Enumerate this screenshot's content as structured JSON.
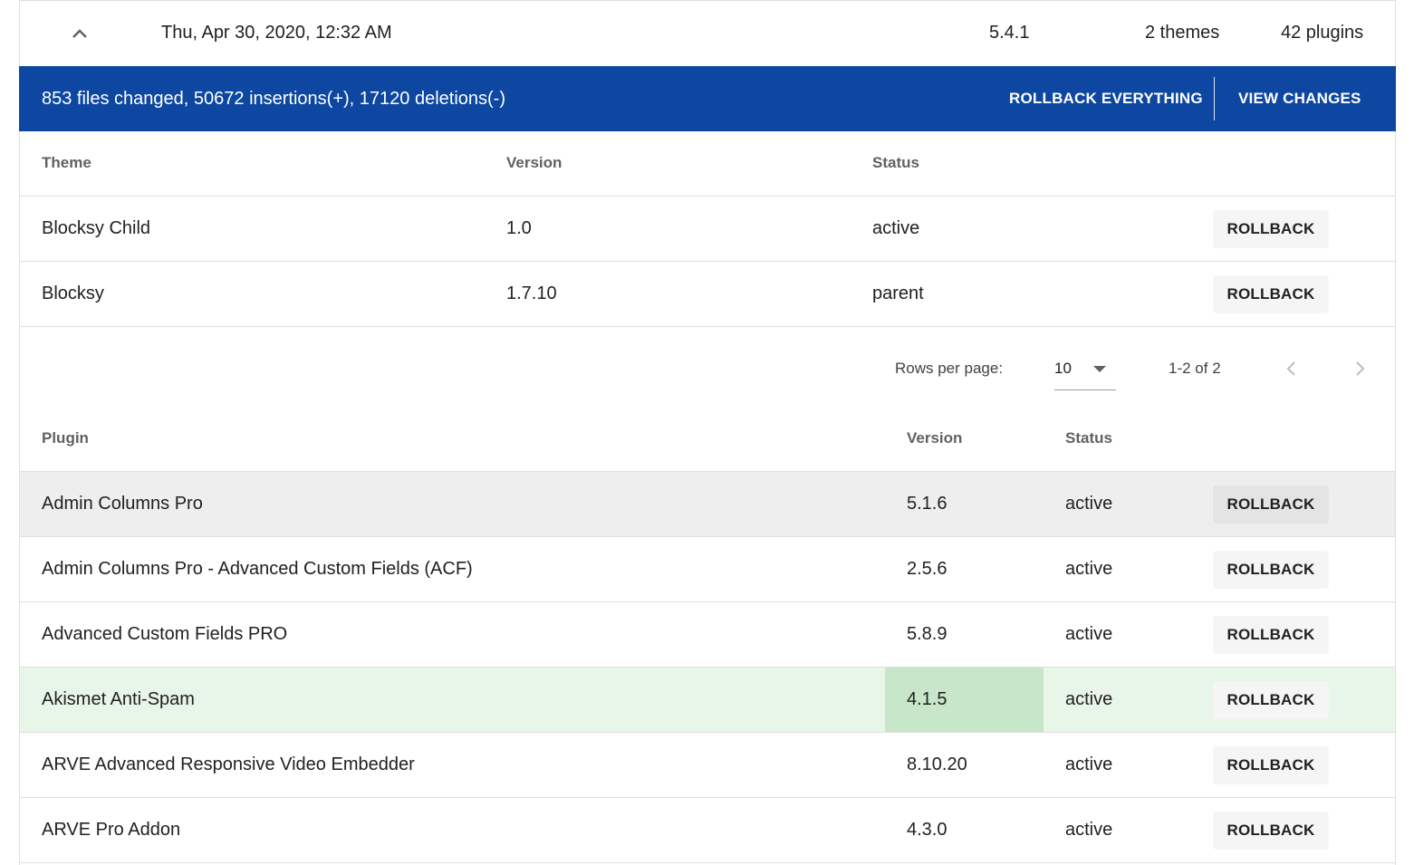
{
  "summary": {
    "date": "Thu, Apr 30, 2020, 12:32 AM",
    "wp_version": "5.4.1",
    "themes_count": "2 themes",
    "plugins_count": "42 plugins"
  },
  "changes": {
    "stats": "853 files changed, 50672 insertions(+), 17120 deletions(-)",
    "rollback_everything_label": "ROLLBACK EVERYTHING",
    "view_changes_label": "VIEW CHANGES",
    "bar_color": "#0d47a1"
  },
  "themes_table": {
    "headers": {
      "name": "Theme",
      "version": "Version",
      "status": "Status"
    },
    "rows": [
      {
        "name": "Blocksy Child",
        "version": "1.0",
        "status": "active",
        "action": "ROLLBACK"
      },
      {
        "name": "Blocksy",
        "version": "1.7.10",
        "status": "parent",
        "action": "ROLLBACK"
      }
    ]
  },
  "pagination": {
    "rows_per_page_label": "Rows per page:",
    "rows_per_page_value": "10",
    "range": "1-2 of 2"
  },
  "plugins_table": {
    "headers": {
      "name": "Plugin",
      "version": "Version",
      "status": "Status"
    },
    "rows": [
      {
        "name": "Admin Columns Pro",
        "version": "5.1.6",
        "status": "active",
        "action": "ROLLBACK"
      },
      {
        "name": "Admin Columns Pro - Advanced Custom Fields (ACF)",
        "version": "2.5.6",
        "status": "active",
        "action": "ROLLBACK"
      },
      {
        "name": "Advanced Custom Fields PRO",
        "version": "5.8.9",
        "status": "active",
        "action": "ROLLBACK"
      },
      {
        "name": "Akismet Anti-Spam",
        "version": "4.1.5",
        "status": "active",
        "action": "ROLLBACK"
      },
      {
        "name": "ARVE Advanced Responsive Video Embedder",
        "version": "8.10.20",
        "status": "active",
        "action": "ROLLBACK"
      },
      {
        "name": "ARVE Pro Addon",
        "version": "4.3.0",
        "status": "active",
        "action": "ROLLBACK"
      }
    ]
  },
  "colors": {
    "hover_row": "#eeeeee",
    "highlight_row": "#e8f5e9",
    "highlight_cell": "#c8e6c9"
  },
  "icons": {
    "collapse": "chevron-up-icon",
    "prev_page": "chevron-left-icon",
    "next_page": "chevron-right-icon",
    "dropdown": "caret-down-icon"
  }
}
